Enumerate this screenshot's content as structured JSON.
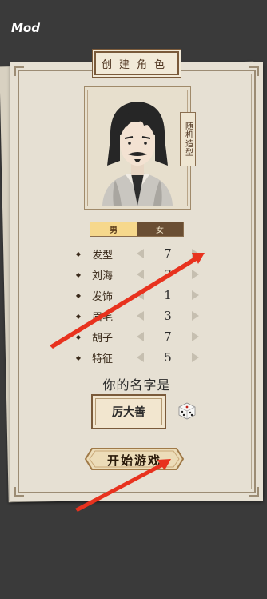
{
  "mod_label": "Mod",
  "title": "创建角色",
  "random_shape_label": "随机造型",
  "gender": {
    "male": "男",
    "female": "女"
  },
  "attributes": [
    {
      "label": "发型",
      "value": "7"
    },
    {
      "label": "刘海",
      "value": "7"
    },
    {
      "label": "发饰",
      "value": "1"
    },
    {
      "label": "眉毛",
      "value": "3"
    },
    {
      "label": "胡子",
      "value": "7"
    },
    {
      "label": "特征",
      "value": "5"
    }
  ],
  "name_prompt": "你的名字是",
  "name_value": "厉大善",
  "start_button": "开始游戏",
  "colors": {
    "background": "#3a3a3a",
    "paper": "#e6e0d3",
    "accent_arrow": "#e8321e",
    "male_selected": "#f6d88c",
    "female_tab": "#6a4e33"
  },
  "icons": [
    "dice-icon",
    "left-arrow-icon",
    "right-arrow-icon"
  ]
}
